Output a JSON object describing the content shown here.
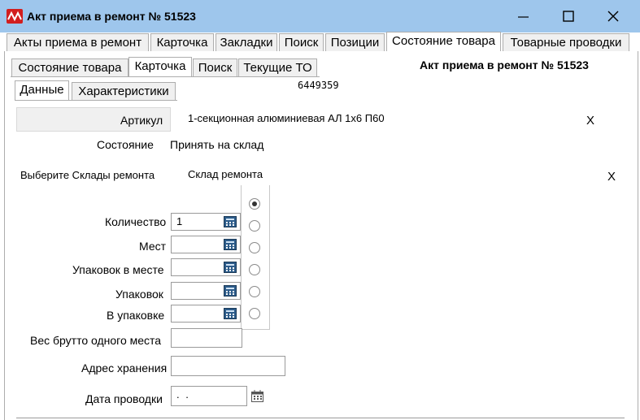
{
  "window": {
    "title": "Акт приема в ремонт № 51523",
    "icon": "app-logo-icon",
    "controls": [
      "minimize-icon",
      "maximize-icon",
      "close-icon"
    ]
  },
  "main_tabs": [
    {
      "label": "Акты приема в ремонт",
      "active": false
    },
    {
      "label": "Карточка",
      "active": false
    },
    {
      "label": "Закладки",
      "active": false
    },
    {
      "label": "Поиск",
      "active": false
    },
    {
      "label": "Позиции",
      "active": false
    },
    {
      "label": "Состояние товара",
      "active": true
    },
    {
      "label": "Товарные проводки",
      "active": false
    }
  ],
  "sub_tabs": [
    {
      "label": "Состояние товара",
      "active": false
    },
    {
      "label": "Карточка",
      "active": true
    },
    {
      "label": "Поиск",
      "active": false
    },
    {
      "label": "Текущие ТО",
      "active": false
    }
  ],
  "inner_tabs": [
    {
      "label": "Данные",
      "active": true
    },
    {
      "label": "Характеристики",
      "active": false
    }
  ],
  "doc_header": "Акт приема в ремонт № 51523",
  "code_field": "6449359",
  "form": {
    "article_label": "Артикул",
    "article_value": "1-секционная алюминиевая АЛ 1х6 П60",
    "article_clear": "X",
    "state_label": "Состояние",
    "state_value": "Принять на склад",
    "warehouse_label": "Выберите Склады ремонта",
    "warehouse_value": "Склад ремонта",
    "warehouse_clear": "X",
    "quantity_label": "Количество",
    "quantity_value": "1",
    "places_label": "Мест",
    "places_value": "",
    "packs_in_place_label": "Упаковок в месте",
    "packs_in_place_value": "",
    "packs_label": "Упаковок",
    "packs_value": "",
    "in_pack_label": "В упаковке",
    "in_pack_value": "",
    "gross_weight_label": "Вес брутто одного места",
    "gross_weight_value": "",
    "storage_address_label": "Адрес хранения",
    "storage_address_value": "",
    "posting_date_label": "Дата проводки",
    "posting_date_value": " .  ."
  },
  "radio_options": [
    {
      "selected": true
    },
    {
      "selected": false
    },
    {
      "selected": false
    },
    {
      "selected": false
    },
    {
      "selected": false
    },
    {
      "selected": false
    }
  ],
  "colors": {
    "titlebar": "#9ec6ec",
    "app_icon": "#d21e1e",
    "border": "#adadad"
  }
}
